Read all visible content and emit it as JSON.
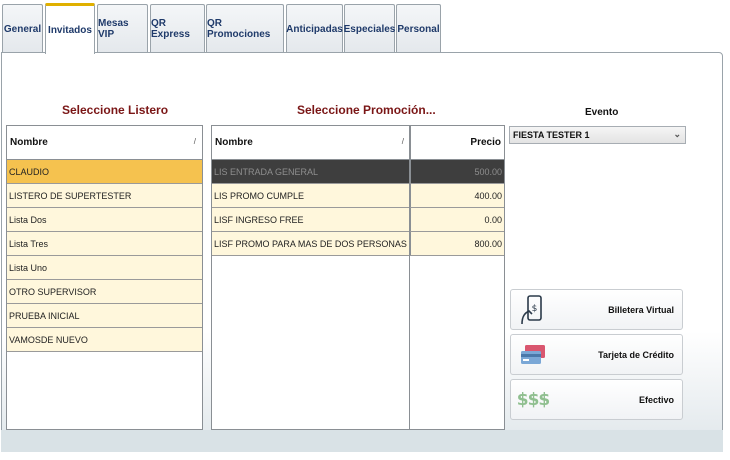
{
  "tabs": [
    {
      "label": "General"
    },
    {
      "label": "Invitados",
      "active": true
    },
    {
      "label": "Mesas VIP"
    },
    {
      "label": "QR Express"
    },
    {
      "label": "QR Promociones"
    },
    {
      "label": "Anticipadas"
    },
    {
      "label": "Especiales"
    },
    {
      "label": "Personal"
    }
  ],
  "listero": {
    "title": "Seleccione Listero",
    "header": "Nombre",
    "rows": [
      "CLAUDIO",
      "LISTERO DE SUPERTESTER",
      "Lista Dos",
      "Lista Tres",
      "Lista Uno",
      "OTRO SUPERVISOR",
      "PRUEBA INICIAL",
      "VAMOSDE NUEVO"
    ],
    "selected_index": 0
  },
  "promocion": {
    "title": "Seleccione Promoción...",
    "header_nombre": "Nombre",
    "header_precio": "Precio",
    "rows": [
      {
        "nombre": "LIS ENTRADA GENERAL",
        "precio": "500.00"
      },
      {
        "nombre": "LIS PROMO CUMPLE",
        "precio": "400.00"
      },
      {
        "nombre": "LISF INGRESO FREE",
        "precio": "0.00"
      },
      {
        "nombre": "LISF PROMO PARA MAS DE DOS PERSONAS",
        "precio": "800.00"
      }
    ],
    "selected_index": 0
  },
  "evento": {
    "label": "Evento",
    "selected": "FIESTA TESTER 1"
  },
  "payment": {
    "billetera": "Billetera Virtual",
    "tarjeta": "Tarjeta de Crédito",
    "efectivo": "Efectivo",
    "cash_glyph": "$$$"
  },
  "colors": {
    "accent_title": "#7a1616",
    "row_bg": "#fff7dc",
    "row_selected_gold": "#f5c24f",
    "row_selected_dark": "#3e3e3e",
    "tab_active_border": "#e0b000"
  }
}
